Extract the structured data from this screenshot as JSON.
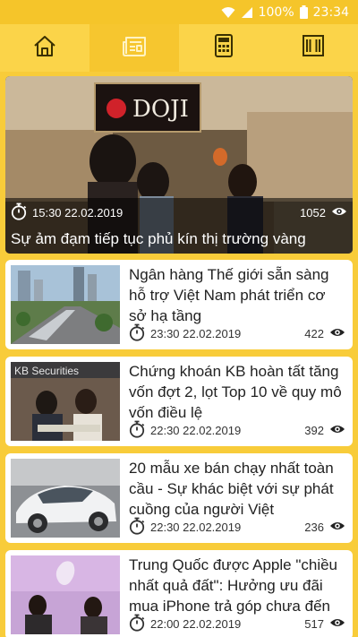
{
  "status_bar": {
    "battery_percent": "100%",
    "clock": "23:34",
    "icons": [
      "wifi-icon",
      "signal-icon",
      "battery-icon"
    ]
  },
  "nav": {
    "tabs": [
      {
        "icon": "home-icon",
        "active": false
      },
      {
        "icon": "newspaper-icon",
        "active": true
      },
      {
        "icon": "calculator-icon",
        "active": false
      },
      {
        "icon": "columns-icon",
        "active": false
      }
    ]
  },
  "hero": {
    "time": "15:30 22.02.2019",
    "views": "1052",
    "title": "Sự ảm đạm tiếp tục phủ kín thị trường vàng",
    "brand_sign": "DOJI"
  },
  "articles": [
    {
      "title": "Ngân hàng Thế giới sẵn sàng hỗ trợ Việt Nam phát triển cơ sở hạ tầng",
      "time": "23:30 22.02.2019",
      "views": "422"
    },
    {
      "title": "Chứng khoán KB hoàn tất tăng vốn đợt 2, lọt Top 10 về quy mô vốn điều lệ",
      "time": "22:30 22.02.2019",
      "views": "392",
      "thumb_sign": "KB Securities"
    },
    {
      "title": "20 mẫu xe bán chạy nhất toàn cầu - Sự khác biệt với sự phát cuồng của người Việt",
      "time": "22:30 22.02.2019",
      "views": "236"
    },
    {
      "title": "Trung Quốc được Apple \"chiều nhất quả đất\": Hưởng ưu đãi mua iPhone trả góp chưa đến",
      "time": "22:00 22.02.2019",
      "views": "517"
    }
  ],
  "colors": {
    "background": "#f8cc3a",
    "nav_bar": "#fbd449",
    "nav_active": "#f6c62f",
    "card": "#ffffff"
  }
}
